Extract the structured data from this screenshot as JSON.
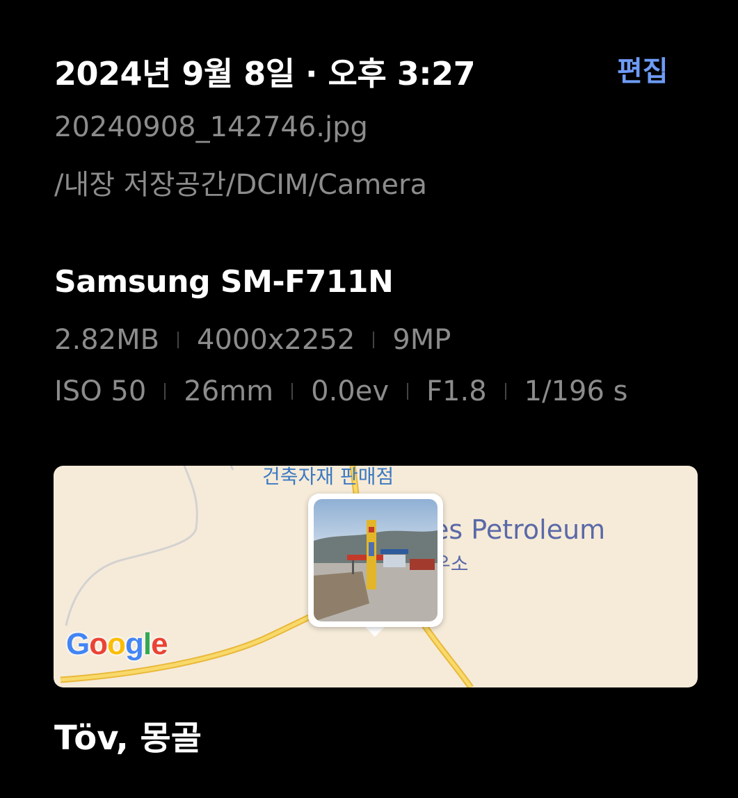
{
  "header": {
    "datetime": "2024년 9월 8일 · 오후 3:27",
    "edit_label": "편집"
  },
  "file": {
    "name": "20240908_142746.jpg",
    "path": "/내장 저장공간/DCIM/Camera"
  },
  "camera": {
    "model": "Samsung SM-F711N",
    "specs_row1": [
      "2.82MB",
      "4000x2252",
      "9MP"
    ],
    "specs_row2": [
      "ISO 50",
      "26mm",
      "0.0ev",
      "F1.8",
      "1/196 s"
    ]
  },
  "map": {
    "labels": {
      "store": "건축자재 판매점",
      "petroleum": "es Petroleum",
      "gas_station": "우소"
    },
    "google_logo": "Google",
    "colors": {
      "land": "#f6ebd9",
      "road": "#f2c84b",
      "google_blue": "#4285f4",
      "google_red": "#ea4335",
      "google_yellow": "#fbbc05",
      "google_green": "#34a853"
    }
  },
  "location": {
    "name": "Töv, 몽골"
  },
  "colors": {
    "accent": "#6e9bf5",
    "secondary_text": "#8c8c8c"
  }
}
